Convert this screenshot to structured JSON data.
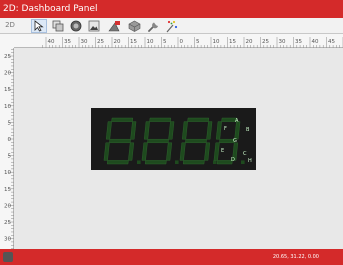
{
  "window": {
    "title": "2D: Dashboard Panel"
  },
  "toolbar": {
    "mode_label": "2D",
    "tools": [
      {
        "name": "select-tool-icon",
        "active": true
      },
      {
        "name": "arrange-tool-icon",
        "active": false
      },
      {
        "name": "gauge-tool-icon",
        "active": false
      },
      {
        "name": "image-tool-icon",
        "active": false
      },
      {
        "name": "shape-tool-icon",
        "active": false
      },
      {
        "name": "object-tool-icon",
        "active": false
      },
      {
        "name": "wrench-tool-icon",
        "active": false
      },
      {
        "name": "magic-tool-icon",
        "active": false
      }
    ]
  },
  "ruler": {
    "horizontal": [
      "40",
      "35",
      "30",
      "25",
      "20",
      "15",
      "10",
      "5",
      "0",
      "5",
      "10",
      "15",
      "20",
      "25",
      "30",
      "35",
      "40",
      "45",
      "50"
    ],
    "vertical": [
      "25",
      "20",
      "15",
      "10",
      "5",
      "0",
      "5",
      "10",
      "15",
      "20",
      "25",
      "30"
    ]
  },
  "display": {
    "digit_color": "#1e4a1e",
    "background": "#1a1a1a",
    "segment_labels": [
      "A",
      "B",
      "C",
      "D",
      "E",
      "F",
      "G",
      "H"
    ]
  },
  "status": {
    "coordinates": "20.65, 31.22, 0.00"
  }
}
